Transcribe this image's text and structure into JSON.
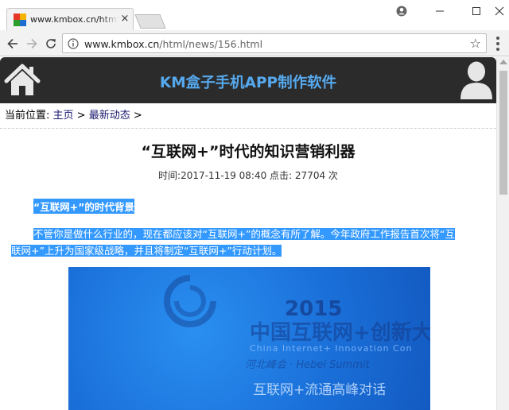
{
  "browser": {
    "tab_title": "www.kmbox.cn/html/n",
    "tab_close": "×",
    "url_host": "www.kmbox.cn",
    "url_path": "/html/news/156.html",
    "star": "☆"
  },
  "site": {
    "title": "KM盒子手机APP制作软件",
    "header_color": "#2b2b2b",
    "title_color": "#56a9ee"
  },
  "breadcrumb": {
    "prefix": "当前位置: ",
    "home": "主页",
    "sep1": " > ",
    "section": "最新动态",
    "sep2": " >"
  },
  "article": {
    "title": "“互联网+”时代的知识营销利器",
    "meta_time_label": "时间:",
    "meta_time": "2017-11-19 08:40",
    "meta_clicks_label": " 点击: ",
    "meta_clicks": "27704",
    "meta_clicks_unit": " 次",
    "subheading": "“互联网+”的时代背景",
    "para_line1": "不管你是做什么行业的，现在都应该对“互联网+”的概念有所了解。今年政府工作报告首次将“互",
    "para_line2": "联网+”上升为国家级战略，并且将制定“互联网+”行动计划。",
    "selection_color": "#3399ff"
  },
  "banner": {
    "year": "2015",
    "cn_title": "中国互联网+创新大",
    "en_title": "China Internet+ Innovation Con",
    "summit": "河北峰会 · Hebei Summit",
    "slogan": "互联网+流通高峰对话"
  },
  "icons": {
    "home": "home-icon",
    "user": "user-icon",
    "back": "arrow-left-icon",
    "forward": "arrow-right-icon",
    "reload": "reload-icon",
    "info": "info-icon",
    "star": "star-icon",
    "menu": "menu-dots-icon"
  }
}
